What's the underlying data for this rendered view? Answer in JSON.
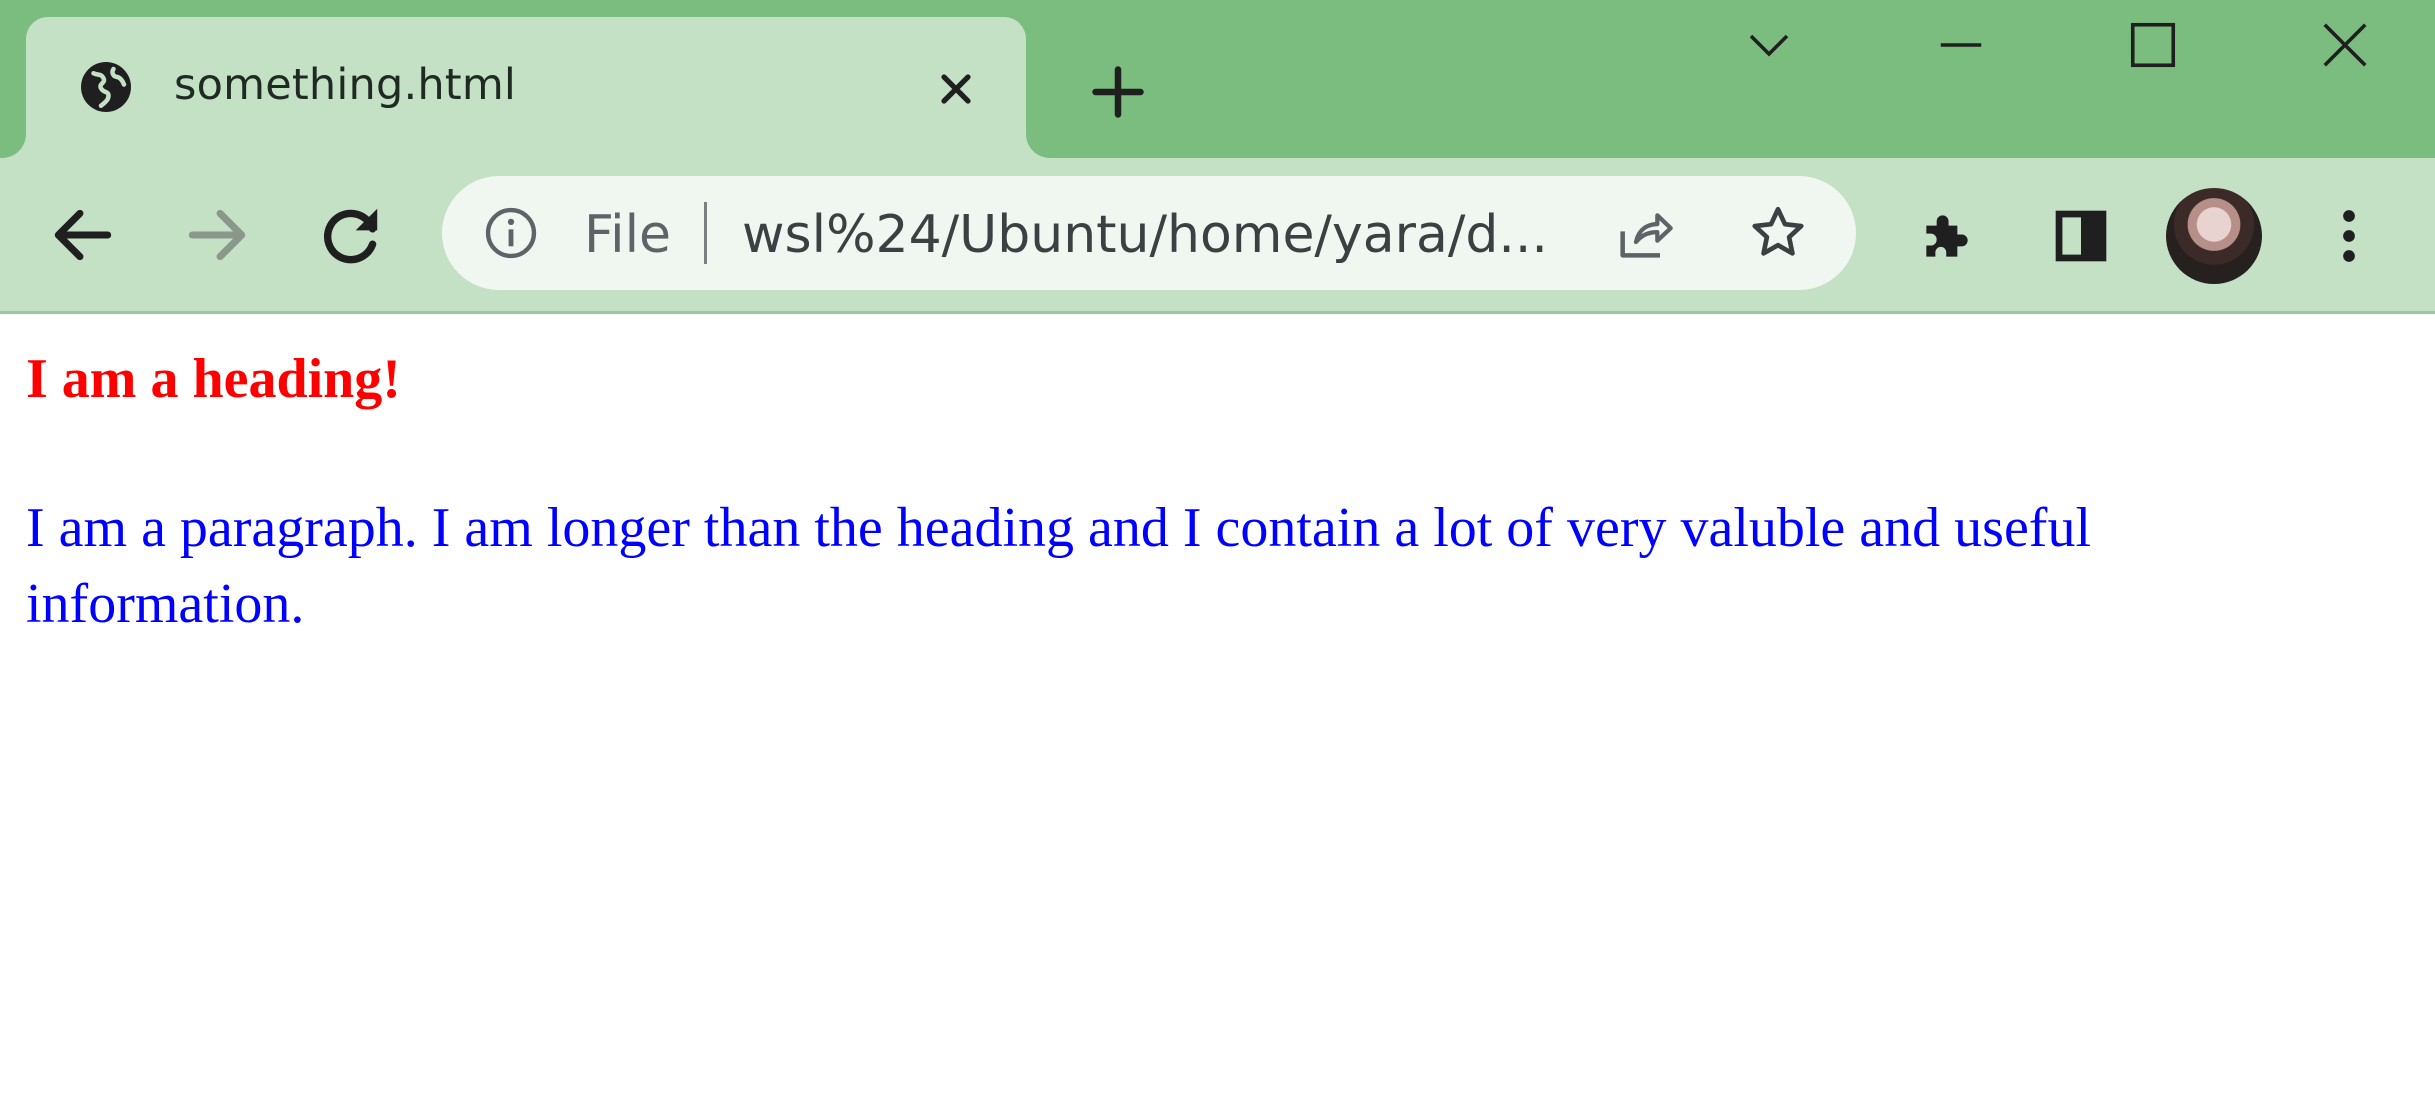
{
  "browser": {
    "tab": {
      "title": "something.html",
      "favicon": "globe-icon",
      "close_icon": "close-icon"
    },
    "new_tab_icon": "plus-icon",
    "window_controls": [
      "chevron-down-icon",
      "minimize-icon",
      "maximize-icon",
      "close-icon"
    ],
    "navigation": [
      "back-arrow-icon",
      "forward-arrow-icon",
      "reload-icon"
    ],
    "omnibox": {
      "info_icon": "info-icon",
      "scheme_label": "File",
      "url": "wsl%24/Ubuntu/home/yara/d...",
      "share_icon": "share-icon",
      "star_icon": "star-icon"
    },
    "toolbar_icons": [
      "extensions-puzzle-icon",
      "side-panel-icon",
      "profile-avatar",
      "kebab-menu-icon"
    ],
    "colors": {
      "tabstrip": "#7bbd7e",
      "active_tab": "#c4e1c6",
      "toolbar": "#c4e1c6",
      "omnibox": "#f0f7f0"
    }
  },
  "page": {
    "heading": "I am a heading!",
    "paragraph": "I am a paragraph. I am longer than the heading and I contain a lot of very valuble and useful information.",
    "colors": {
      "heading": "#ff0000",
      "paragraph": "#0000ff",
      "background": "#ffffff"
    }
  }
}
